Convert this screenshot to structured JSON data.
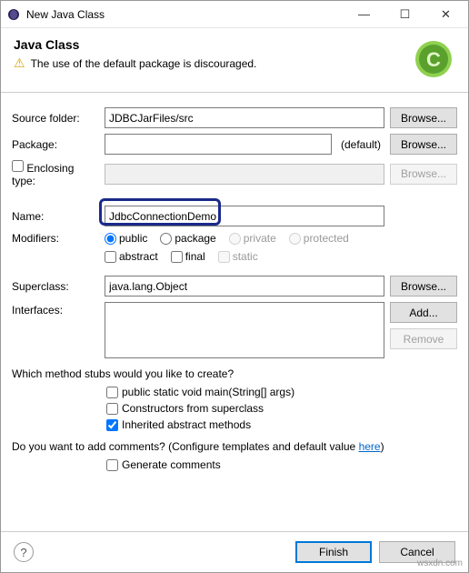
{
  "window": {
    "title": "New Java Class"
  },
  "header": {
    "title": "Java Class",
    "warning": "The use of the default package is discouraged."
  },
  "labels": {
    "sourceFolder": "Source folder:",
    "package": "Package:",
    "defaultPkg": "(default)",
    "enclosingType": "Enclosing type:",
    "name": "Name:",
    "modifiers": "Modifiers:",
    "superclass": "Superclass:",
    "interfaces": "Interfaces:"
  },
  "fields": {
    "sourceFolder": "JDBCJarFiles/src",
    "package": "",
    "enclosingType": "",
    "name": "JdbcConnectionDemo",
    "superclass": "java.lang.Object"
  },
  "buttons": {
    "browse": "Browse...",
    "add": "Add...",
    "remove": "Remove",
    "finish": "Finish",
    "cancel": "Cancel"
  },
  "modifiers": {
    "public": "public",
    "package": "package",
    "private": "private",
    "protected": "protected",
    "abstract": "abstract",
    "final": "final",
    "static": "static"
  },
  "stubs": {
    "question": "Which method stubs would you like to create?",
    "main": "public static void main(String[] args)",
    "constructors": "Constructors from superclass",
    "inherited": "Inherited abstract methods"
  },
  "comments": {
    "prefix": "Do you want to add comments? (Configure templates and default value ",
    "link": "here",
    "suffix": ")",
    "generate": "Generate comments"
  },
  "watermark": "wsxdn.com"
}
